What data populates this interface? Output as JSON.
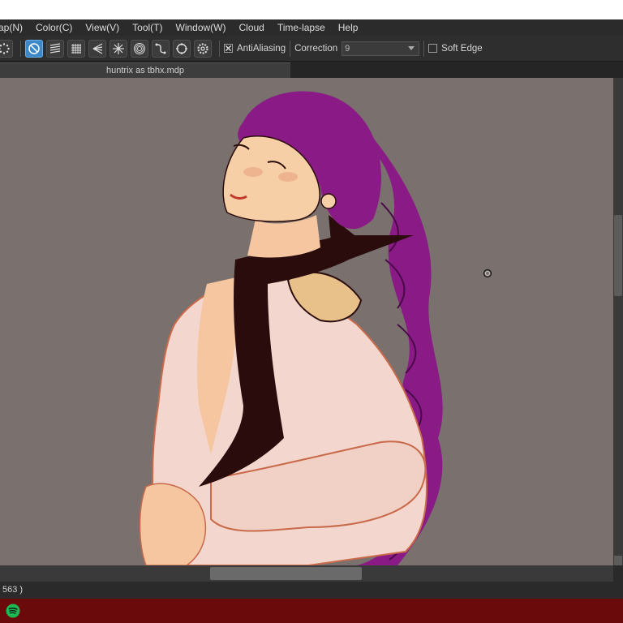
{
  "menu": [
    {
      "label": "ap(N)"
    },
    {
      "label": "Color(C)"
    },
    {
      "label": "View(V)"
    },
    {
      "label": "Tool(T)"
    },
    {
      "label": "Window(W)"
    },
    {
      "label": "Cloud"
    },
    {
      "label": "Time-lapse"
    },
    {
      "label": "Help"
    }
  ],
  "toolbar": {
    "buttons": [
      {
        "icon": "loading-dots-icon",
        "active": false
      },
      {
        "icon": "no-ruler-icon",
        "active": true
      },
      {
        "icon": "parallel-lines-ruler-icon",
        "active": false
      },
      {
        "icon": "grid-ruler-icon",
        "active": false
      },
      {
        "icon": "perspective-ruler-icon",
        "active": false
      },
      {
        "icon": "radial-lines-ruler-icon",
        "active": false
      },
      {
        "icon": "concentric-circle-ruler-icon",
        "active": false
      },
      {
        "icon": "curve-ruler-icon",
        "active": false
      },
      {
        "icon": "ellipse-ruler-icon",
        "active": false
      },
      {
        "icon": "gear-icon",
        "active": false
      }
    ],
    "antialiasing_label": "AntiAliasing",
    "antialiasing_checked": true,
    "correction_label": "Correction",
    "correction_value": "9",
    "soft_edge_label": "Soft Edge",
    "soft_edge_checked": false
  },
  "tab": {
    "title": "huntrix as tbhx.mdp"
  },
  "status": {
    "text": "563 )"
  },
  "taskbar": {
    "app_icon": "spotify-icon",
    "color": "#6a0a0a"
  },
  "colors": {
    "canvas_bg": "#7a716e",
    "active_button": "#3c88c8",
    "hair": "#8a1a86",
    "skin": "#f7cfa6",
    "jacket": "#f3d6cd",
    "scarf": "#2a0c0c"
  }
}
